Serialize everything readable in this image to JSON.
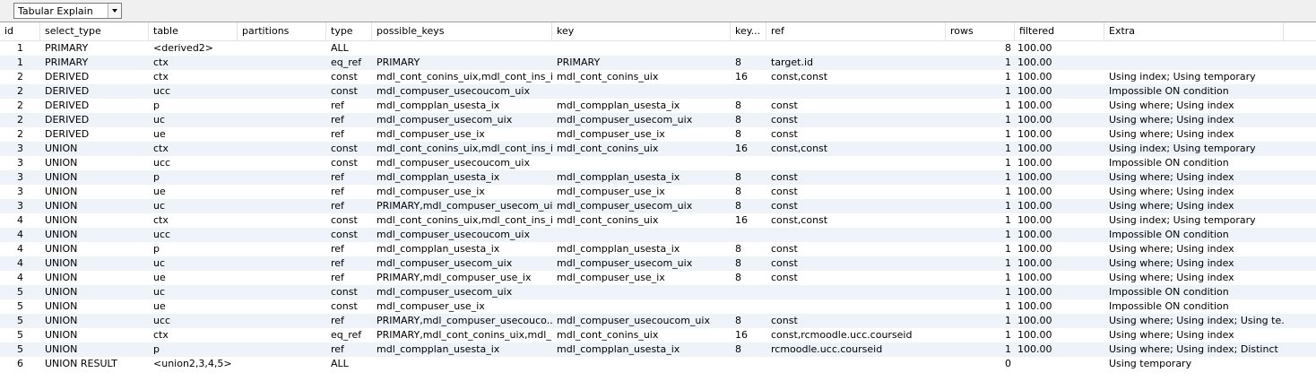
{
  "toolbar": {
    "view_select_value": "Tabular Explain"
  },
  "columns": [
    "id",
    "select_type",
    "table",
    "partitions",
    "type",
    "possible_keys",
    "key",
    "key...",
    "ref",
    "rows",
    "filtered",
    "Extra"
  ],
  "rows": [
    [
      "1",
      "PRIMARY",
      "<derived2>",
      "",
      "ALL",
      "",
      "",
      "",
      "",
      "8",
      "100.00",
      ""
    ],
    [
      "1",
      "PRIMARY",
      "ctx",
      "",
      "eq_ref",
      "PRIMARY",
      "PRIMARY",
      "8",
      "target.id",
      "1",
      "100.00",
      ""
    ],
    [
      "2",
      "DERIVED",
      "ctx",
      "",
      "const",
      "mdl_cont_conins_uix,mdl_cont_ins_ix",
      "mdl_cont_conins_uix",
      "16",
      "const,const",
      "1",
      "100.00",
      "Using index; Using temporary"
    ],
    [
      "2",
      "DERIVED",
      "ucc",
      "",
      "const",
      "mdl_compuser_usecoucom_uix",
      "",
      "",
      "",
      "1",
      "100.00",
      "Impossible ON condition"
    ],
    [
      "2",
      "DERIVED",
      "p",
      "",
      "ref",
      "mdl_compplan_usesta_ix",
      "mdl_compplan_usesta_ix",
      "8",
      "const",
      "1",
      "100.00",
      "Using where; Using index"
    ],
    [
      "2",
      "DERIVED",
      "uc",
      "",
      "ref",
      "mdl_compuser_usecom_uix",
      "mdl_compuser_usecom_uix",
      "8",
      "const",
      "1",
      "100.00",
      "Using where; Using index"
    ],
    [
      "2",
      "DERIVED",
      "ue",
      "",
      "ref",
      "mdl_compuser_use_ix",
      "mdl_compuser_use_ix",
      "8",
      "const",
      "1",
      "100.00",
      "Using where; Using index"
    ],
    [
      "3",
      "UNION",
      "ctx",
      "",
      "const",
      "mdl_cont_conins_uix,mdl_cont_ins_ix",
      "mdl_cont_conins_uix",
      "16",
      "const,const",
      "1",
      "100.00",
      "Using index; Using temporary"
    ],
    [
      "3",
      "UNION",
      "ucc",
      "",
      "const",
      "mdl_compuser_usecoucom_uix",
      "",
      "",
      "",
      "1",
      "100.00",
      "Impossible ON condition"
    ],
    [
      "3",
      "UNION",
      "p",
      "",
      "ref",
      "mdl_compplan_usesta_ix",
      "mdl_compplan_usesta_ix",
      "8",
      "const",
      "1",
      "100.00",
      "Using where; Using index"
    ],
    [
      "3",
      "UNION",
      "ue",
      "",
      "ref",
      "mdl_compuser_use_ix",
      "mdl_compuser_use_ix",
      "8",
      "const",
      "1",
      "100.00",
      "Using where; Using index"
    ],
    [
      "3",
      "UNION",
      "uc",
      "",
      "ref",
      "PRIMARY,mdl_compuser_usecom_uix",
      "mdl_compuser_usecom_uix",
      "8",
      "const",
      "1",
      "100.00",
      "Using where; Using index"
    ],
    [
      "4",
      "UNION",
      "ctx",
      "",
      "const",
      "mdl_cont_conins_uix,mdl_cont_ins_ix",
      "mdl_cont_conins_uix",
      "16",
      "const,const",
      "1",
      "100.00",
      "Using index; Using temporary"
    ],
    [
      "4",
      "UNION",
      "ucc",
      "",
      "const",
      "mdl_compuser_usecoucom_uix",
      "",
      "",
      "",
      "1",
      "100.00",
      "Impossible ON condition"
    ],
    [
      "4",
      "UNION",
      "p",
      "",
      "ref",
      "mdl_compplan_usesta_ix",
      "mdl_compplan_usesta_ix",
      "8",
      "const",
      "1",
      "100.00",
      "Using where; Using index"
    ],
    [
      "4",
      "UNION",
      "uc",
      "",
      "ref",
      "mdl_compuser_usecom_uix",
      "mdl_compuser_usecom_uix",
      "8",
      "const",
      "1",
      "100.00",
      "Using where; Using index"
    ],
    [
      "4",
      "UNION",
      "ue",
      "",
      "ref",
      "PRIMARY,mdl_compuser_use_ix",
      "mdl_compuser_use_ix",
      "8",
      "const",
      "1",
      "100.00",
      "Using where; Using index"
    ],
    [
      "5",
      "UNION",
      "uc",
      "",
      "const",
      "mdl_compuser_usecom_uix",
      "",
      "",
      "",
      "1",
      "100.00",
      "Impossible ON condition"
    ],
    [
      "5",
      "UNION",
      "ue",
      "",
      "const",
      "mdl_compuser_use_ix",
      "",
      "",
      "",
      "1",
      "100.00",
      "Impossible ON condition"
    ],
    [
      "5",
      "UNION",
      "ucc",
      "",
      "ref",
      "PRIMARY,mdl_compuser_usecouco...",
      "mdl_compuser_usecoucom_uix",
      "8",
      "const",
      "1",
      "100.00",
      "Using where; Using index; Using te..."
    ],
    [
      "5",
      "UNION",
      "ctx",
      "",
      "eq_ref",
      "PRIMARY,mdl_cont_conins_uix,mdl_...",
      "mdl_cont_conins_uix",
      "16",
      "const,rcmoodle.ucc.courseid",
      "1",
      "100.00",
      "Using where; Using index"
    ],
    [
      "5",
      "UNION",
      "p",
      "",
      "ref",
      "mdl_compplan_usesta_ix",
      "mdl_compplan_usesta_ix",
      "8",
      "rcmoodle.ucc.courseid",
      "1",
      "100.00",
      "Using where; Using index; Distinct"
    ],
    [
      "6",
      "UNION RESULT",
      "<union2,3,4,5>",
      "",
      "ALL",
      "",
      "",
      "",
      "",
      "0",
      "",
      "Using temporary"
    ]
  ]
}
